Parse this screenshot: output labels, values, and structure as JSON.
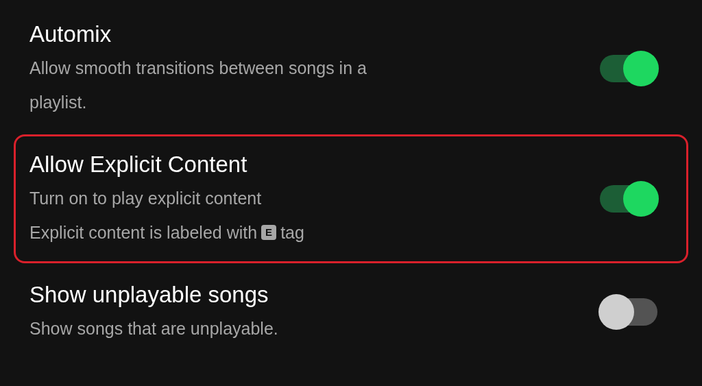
{
  "settings": [
    {
      "title": "Automix",
      "lines": [
        {
          "text": "Allow smooth transitions between songs in a"
        },
        {
          "text": "playlist."
        }
      ],
      "on": true,
      "highlighted": false
    },
    {
      "title": "Allow Explicit Content",
      "lines": [
        {
          "text": "Turn on to play explicit content"
        },
        {
          "text": "Explicit content is labeled with",
          "badge": "E",
          "after": "tag"
        }
      ],
      "on": true,
      "highlighted": true
    },
    {
      "title": "Show unplayable songs",
      "lines": [
        {
          "text": "Show songs that are unplayable."
        }
      ],
      "on": false,
      "highlighted": false
    }
  ]
}
